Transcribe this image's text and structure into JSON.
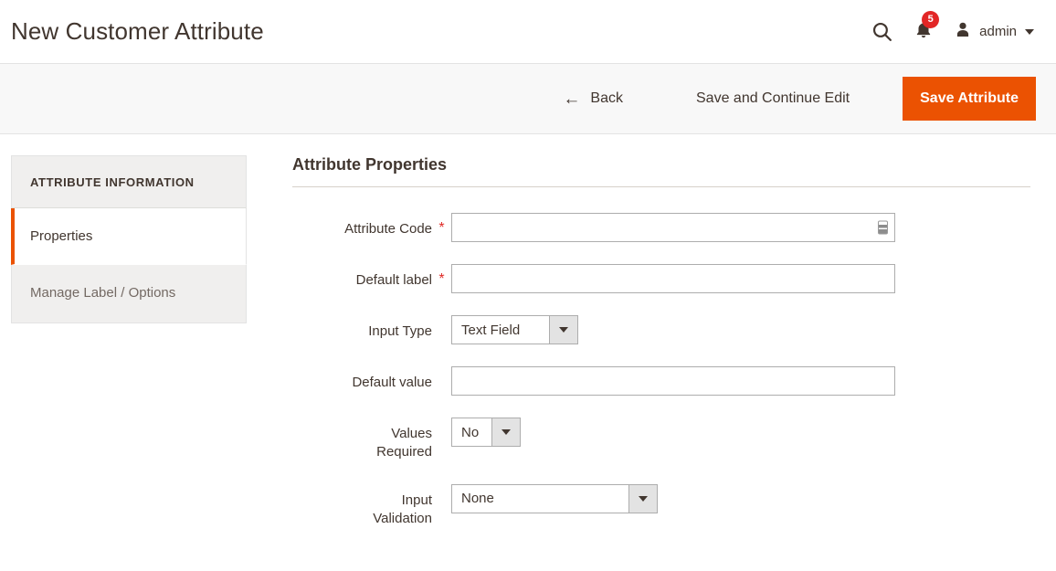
{
  "header": {
    "title": "New Customer Attribute",
    "search_icon": "search-icon",
    "notification_icon": "bell-icon",
    "notification_count": "5",
    "user_icon": "user-avatar-icon",
    "user_name": "admin",
    "caret_icon": "chevron-down-icon"
  },
  "page_actions": {
    "back_arrow": "←",
    "back_label": "Back",
    "save_continue_label": "Save and Continue Edit",
    "save_label": "Save Attribute",
    "primary_color": "#eb5202"
  },
  "sidebar": {
    "title": "ATTRIBUTE INFORMATION",
    "items": [
      {
        "label": "Properties",
        "active": true
      },
      {
        "label": "Manage Label / Options",
        "active": false
      }
    ]
  },
  "form": {
    "section_title": "Attribute Properties",
    "required_marker": "*",
    "fields": {
      "attribute_code": {
        "label": "Attribute Code",
        "value": "",
        "glyph": "autofill-icon"
      },
      "default_label": {
        "label": "Default label",
        "value": ""
      },
      "input_type": {
        "label": "Input Type",
        "value": "Text Field"
      },
      "default_value": {
        "label": "Default value",
        "value": ""
      },
      "values_required": {
        "label_line1": "Values",
        "label_line2": "Required",
        "value": "No"
      },
      "input_validation": {
        "label_line1": "Input",
        "label_line2": "Validation",
        "value": "None"
      }
    }
  }
}
